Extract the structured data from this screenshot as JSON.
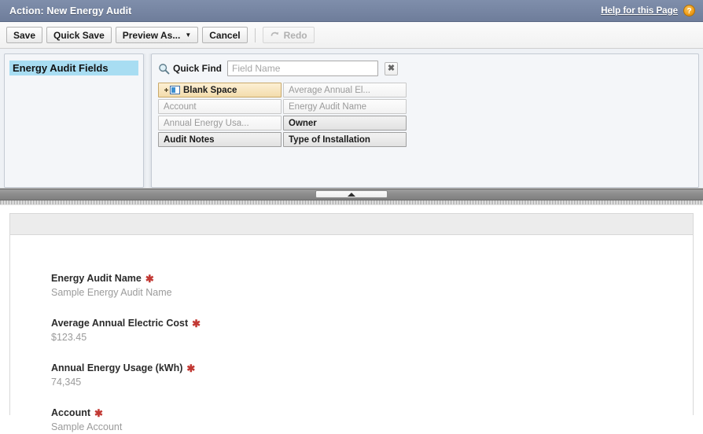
{
  "header": {
    "title": "Action: New Energy Audit",
    "help_label": "Help for this Page",
    "help_icon": "question-mark-icon",
    "accent_bg": "#7786a3",
    "help_icon_color": "#f0a01c"
  },
  "toolbar": {
    "save_label": "Save",
    "quick_save_label": "Quick Save",
    "preview_as_label": "Preview As...",
    "preview_as_caret": "▼",
    "cancel_label": "Cancel",
    "redo_label": "Redo",
    "redo_icon": "redo-arrow-icon",
    "redo_disabled": true
  },
  "sidebar": {
    "items": [
      {
        "label": "Energy Audit Fields",
        "selected": true
      }
    ],
    "selected_color": "#a8ddf2"
  },
  "palette": {
    "quick_find": {
      "icon": "search-icon",
      "label": "Quick Find",
      "value": "",
      "placeholder": "Field Name",
      "clear_label": "✖"
    },
    "tiles": [
      {
        "label": "Blank Space",
        "state": "highlight",
        "icon": "blank-space-icon"
      },
      {
        "label": "Average Annual El...",
        "state": "used"
      },
      {
        "label": "Account",
        "state": "used"
      },
      {
        "label": "Energy Audit Name",
        "state": "used"
      },
      {
        "label": "Annual Energy Usa...",
        "state": "used"
      },
      {
        "label": "Owner",
        "state": "available"
      },
      {
        "label": "Audit Notes",
        "state": "available"
      },
      {
        "label": "Type of Installation",
        "state": "available"
      }
    ]
  },
  "splitter": {
    "collapse_icon": "up-triangle-icon"
  },
  "preview": {
    "fields": [
      {
        "label": "Energy Audit Name",
        "required": true,
        "required_mark": "✱",
        "value": "Sample Energy Audit Name"
      },
      {
        "label": "Average Annual Electric Cost",
        "required": true,
        "required_mark": "✱",
        "value": "$123.45"
      },
      {
        "label": "Annual Energy Usage (kWh)",
        "required": true,
        "required_mark": "✱",
        "value": "74,345"
      },
      {
        "label": "Account",
        "required": true,
        "required_mark": "✱",
        "value": "Sample Account"
      }
    ],
    "required_color": "#c23934"
  }
}
